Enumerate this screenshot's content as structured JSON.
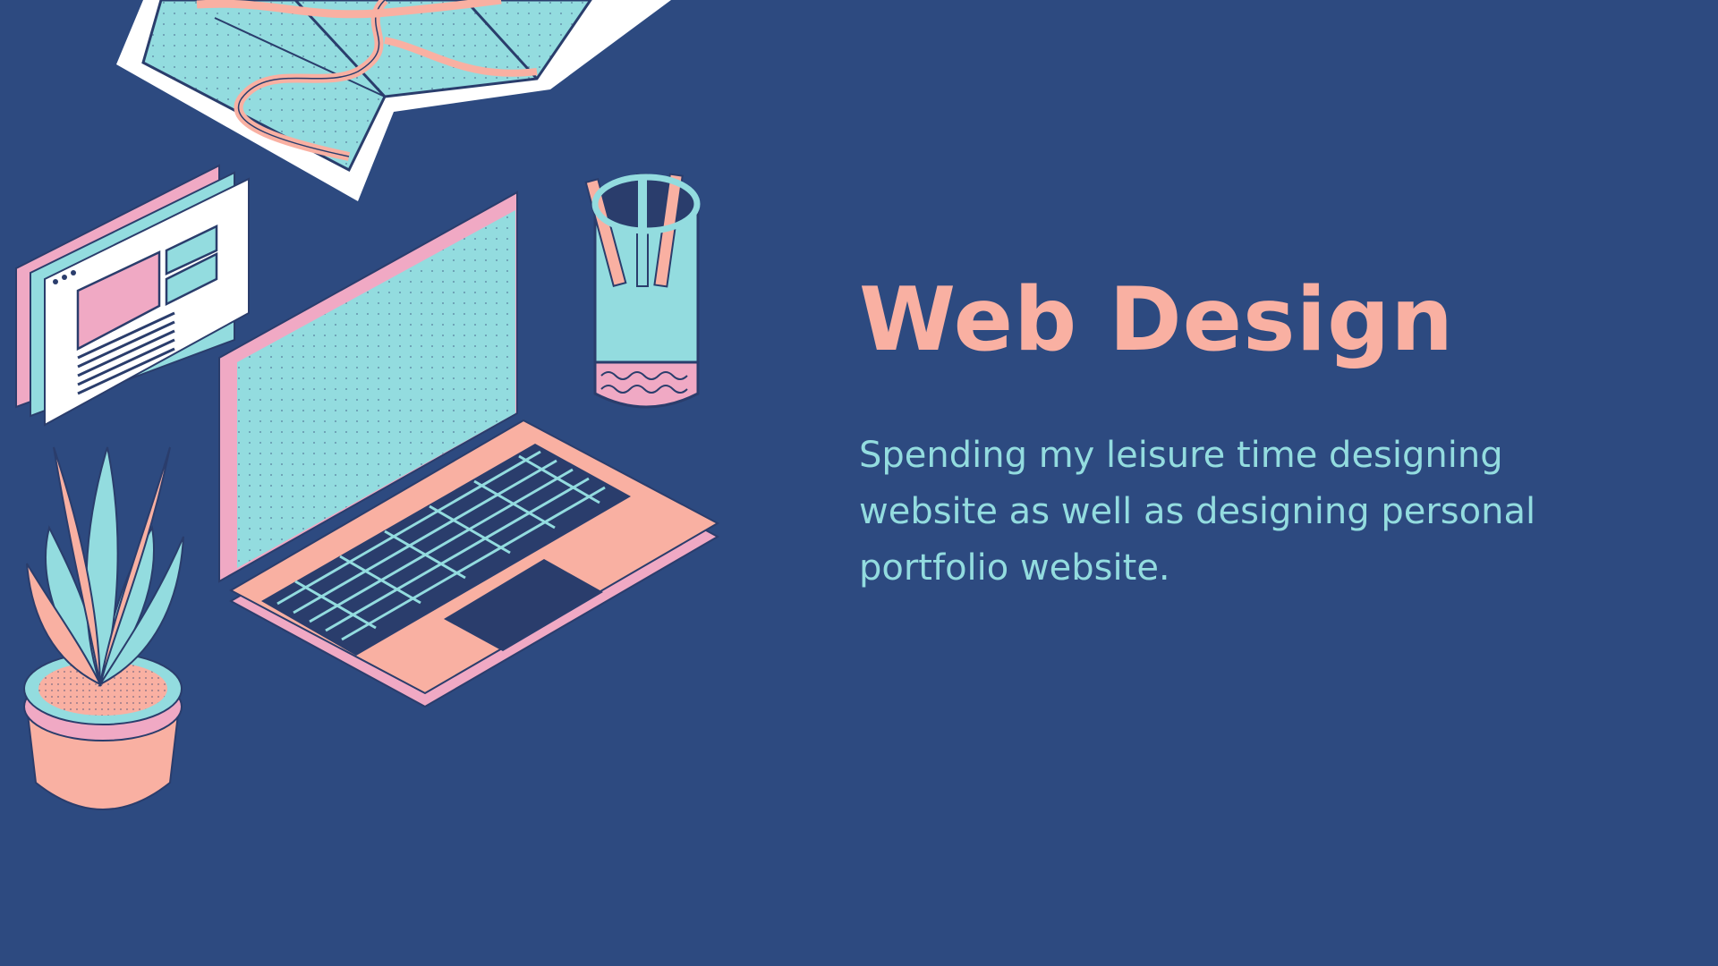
{
  "slide": {
    "title": "Web Design",
    "description": "Spending my leisure time designing website as well as designing personal portfolio website."
  },
  "illustration": {
    "items": [
      "folded-map",
      "browser-windows",
      "laptop",
      "pencil-cup",
      "potted-plant"
    ]
  },
  "colors": {
    "background": "#2d4a80",
    "title": "#f9b0a2",
    "body_text": "#93dcdf",
    "teal": "#93dcdf",
    "salmon": "#f9b0a2",
    "pink": "#f0a9c4",
    "outline": "#2a3d6c",
    "white": "#ffffff"
  }
}
